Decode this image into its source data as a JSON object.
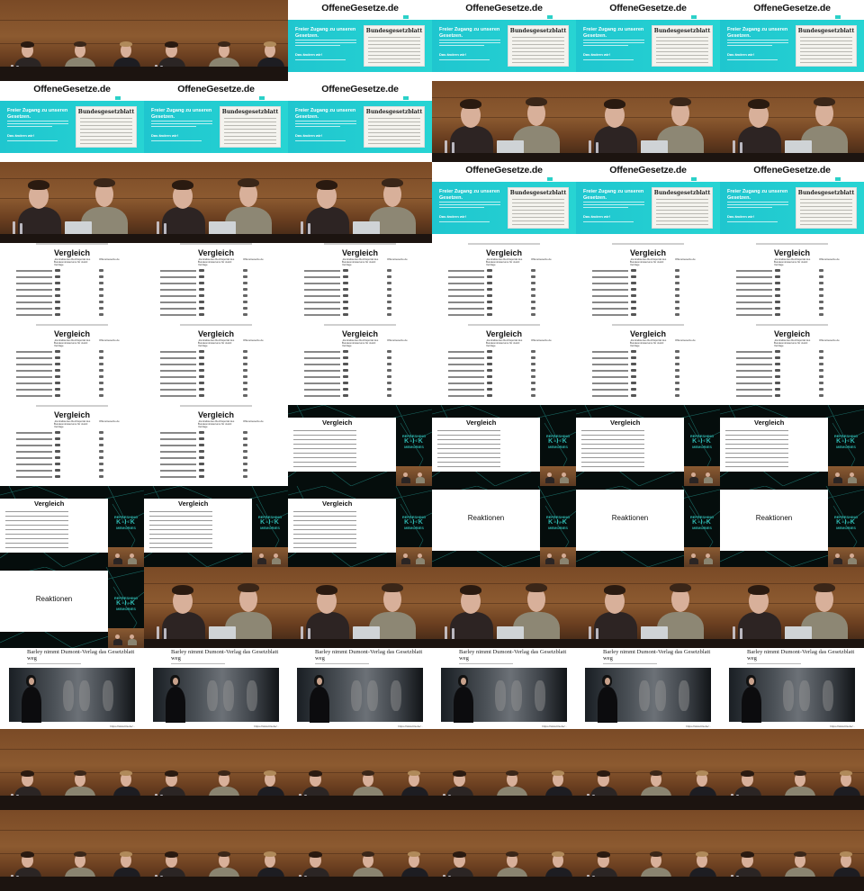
{
  "site": {
    "logo": "OffeneGesetze.de",
    "hero_title": "Freier Zugang zu unseren Gesetzen.",
    "hero_sub": "Das ändern wir!",
    "paper_title": "Bundesgesetzblatt"
  },
  "slide": {
    "title": "Vergleich",
    "col1": "„Zentralisiertes Rechtsportal des Bundesministeriums für Justiz: Verträge",
    "col2": "OffeneGesetze.de"
  },
  "network": {
    "brand_top": "REFRESHING",
    "brand_mid": "K-I-K",
    "brand_bottom": "MEMORIES"
  },
  "reactions": {
    "title": "Reaktionen"
  },
  "news": {
    "headline": "Barley nimmt Dumont-Verlag das Gesetzblatt weg",
    "url": "https://www.bla.de/..."
  },
  "tiles": [
    "stage3",
    "stage3",
    "site",
    "site",
    "site",
    "site",
    "site",
    "site",
    "site",
    "stage2",
    "stage2",
    "stage2",
    "stage2",
    "stage2",
    "stage2",
    "site",
    "site",
    "site",
    "slide",
    "slide",
    "slide",
    "slide",
    "slide",
    "slide",
    "slide",
    "slide",
    "slide",
    "slide",
    "slide",
    "slide",
    "slide",
    "slide",
    "net-slide",
    "net-slide",
    "net-slide",
    "net-slide",
    "net-slide",
    "net-slide",
    "net-slide",
    "net-react",
    "net-react",
    "net-react",
    "net-react",
    "stage2",
    "stage2",
    "stage2",
    "stage2",
    "stage2",
    "news",
    "news",
    "news",
    "news",
    "news",
    "news",
    "stage3",
    "stage3",
    "stage3",
    "stage3",
    "stage3",
    "stage3",
    "stage3",
    "stage3",
    "stage3",
    "stage3",
    "stage3",
    "stage3"
  ]
}
